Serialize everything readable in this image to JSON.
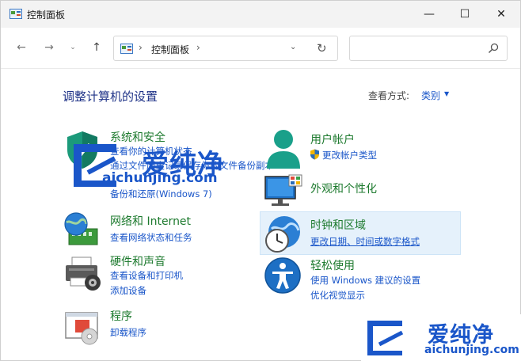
{
  "window": {
    "title": "控制面板",
    "controls": {
      "minimize": "—",
      "maximize": "☐",
      "close": "✕"
    }
  },
  "nav": {
    "back": "←",
    "forward": "→",
    "recent": "⌄",
    "up": "↑",
    "address": {
      "separator": "›",
      "crumb": "控制面板",
      "dropdown": "⌄",
      "refresh": "↻"
    },
    "search": {
      "placeholder": ""
    }
  },
  "main": {
    "heading": "调整计算机的设置",
    "view_by": {
      "label": "查看方式:",
      "value": "类别"
    }
  },
  "categories": [
    {
      "icon": "shield-icon",
      "title": "系统和安全",
      "links": [
        "查看你的计算机状态",
        "通过文件历史记录保存你的文件备份副本",
        "备份和还原(Windows 7)"
      ]
    },
    {
      "icon": "user-icon",
      "title": "用户帐户",
      "links": [
        "更改帐户类型"
      ]
    },
    {
      "icon": "network-globe-icon",
      "title": "网络和 Internet",
      "links": [
        "查看网络状态和任务"
      ]
    },
    {
      "icon": "monitor-icon",
      "title": "外观和个性化",
      "links": []
    },
    {
      "icon": "printer-icon",
      "title": "硬件和声音",
      "links": [
        "查看设备和打印机",
        "添加设备"
      ]
    },
    {
      "icon": "clock-globe-icon",
      "title": "时钟和区域",
      "links": [
        "更改日期、时间或数字格式"
      ]
    },
    {
      "icon": "accessibility-icon",
      "title": "轻松使用",
      "links": [
        "使用 Windows 建议的设置",
        "优化视觉显示"
      ]
    },
    {
      "icon": "programs-icon",
      "title": "程序",
      "links": [
        "卸载程序"
      ]
    }
  ],
  "watermark": {
    "brand": "爱纯净",
    "url": "aichunjing.com"
  },
  "colors": {
    "title_green": "#1d7a2e",
    "link_blue": "#1a56c9",
    "heading_blue": "#1e3287",
    "highlight": "#e5f1fb"
  }
}
